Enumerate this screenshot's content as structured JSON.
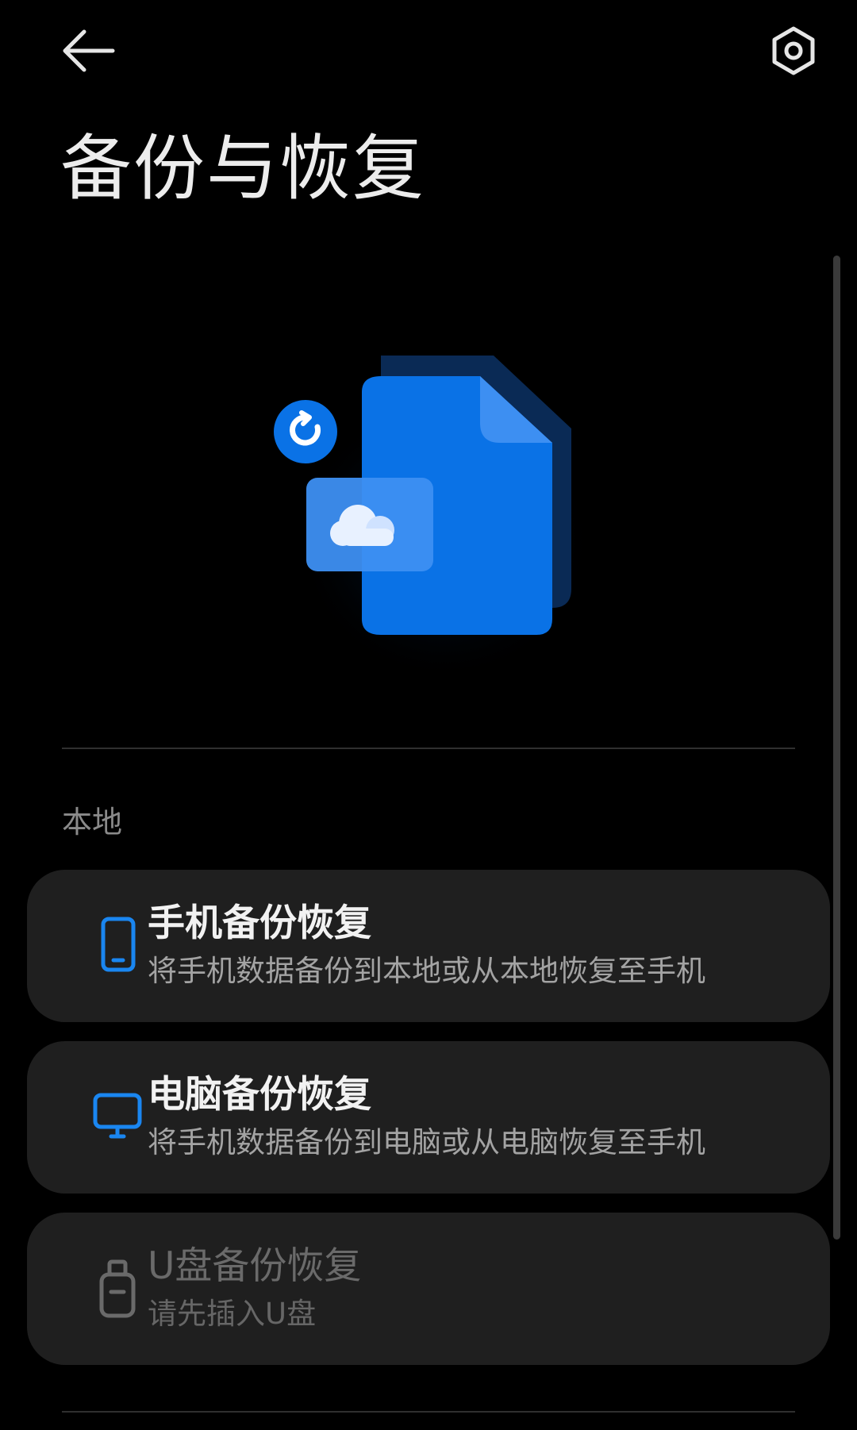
{
  "header": {
    "back_icon": "arrow-left-icon",
    "settings_icon": "hexagon-settings-icon",
    "title": "备份与恢复"
  },
  "hero": {
    "icon": "document-cloud-restore-illustration",
    "colors": {
      "primary": "#0a72e6",
      "light": "#3d8ff2",
      "dark": "#0a2a55"
    }
  },
  "section": {
    "label": "本地"
  },
  "options": [
    {
      "icon": "phone-icon",
      "title": "手机备份恢复",
      "subtitle": "将手机数据备份到本地或从本地恢复至手机",
      "enabled": true
    },
    {
      "icon": "monitor-icon",
      "title": "电脑备份恢复",
      "subtitle": "将手机数据备份到电脑或从电脑恢复至手机",
      "enabled": true
    },
    {
      "icon": "usb-drive-icon",
      "title": "U盘备份恢复",
      "subtitle": "请先插入U盘",
      "enabled": false
    }
  ],
  "colors": {
    "background": "#000000",
    "card": "#1f1f1f",
    "accent": "#1a86f0",
    "disabled": "#6a6a6a"
  }
}
